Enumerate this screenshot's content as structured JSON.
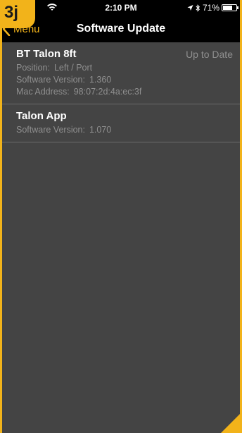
{
  "status_bar": {
    "time": "2:10 PM",
    "battery_text": "71%",
    "battery_level": 0.71,
    "icons": [
      "wifi-icon",
      "location-arrow-icon",
      "bluetooth-icon",
      "battery-icon"
    ]
  },
  "logo": {
    "text": "3j"
  },
  "nav": {
    "back_label": "Menu",
    "title": "Software Update"
  },
  "items": [
    {
      "title": "BT Talon 8ft",
      "status": "Up to Date",
      "lines": [
        {
          "label": "Position:",
          "value": "Left / Port"
        },
        {
          "label": "Software Version:",
          "value": "1.360"
        },
        {
          "label": "Mac Address:",
          "value": "98:07:2d:4a:ec:3f"
        }
      ]
    },
    {
      "title": "Talon App",
      "lines": [
        {
          "label": "Software Version:",
          "value": "1.070"
        }
      ]
    }
  ],
  "colors": {
    "accent": "#f2b31a",
    "background": "#444444",
    "bar": "#000000",
    "text_primary": "#ffffff",
    "text_secondary": "#8f8f8f",
    "divider": "#6b6b6b"
  }
}
